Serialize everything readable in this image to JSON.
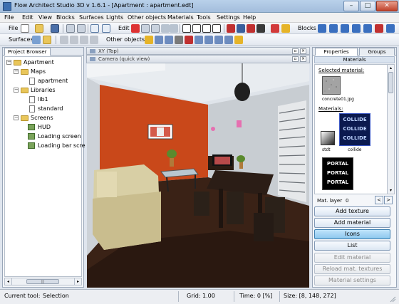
{
  "window": {
    "title": "Flow Architect Studio 3D v 1.6.1 - [Apartment : apartment.edt]",
    "minimize": "–",
    "maximize": "□",
    "close": "✕"
  },
  "menu": [
    "File",
    "Edit",
    "View",
    "Blocks",
    "Surfaces",
    "Lights",
    "Other objects",
    "Materials",
    "Tools",
    "Settings",
    "Help"
  ],
  "toolbar1": {
    "file": "File",
    "edit": "Edit",
    "blocks": "Blocks"
  },
  "toolbar2": {
    "surfaces": "Surfaces",
    "other_objects": "Other objects"
  },
  "project_browser": {
    "tab": "Project Browser",
    "tree": [
      {
        "label": "Apartment",
        "level": 0,
        "kind": "folder"
      },
      {
        "label": "Maps",
        "level": 1,
        "kind": "folder"
      },
      {
        "label": "apartment",
        "level": 2,
        "kind": "file"
      },
      {
        "label": "Libraries",
        "level": 1,
        "kind": "folder"
      },
      {
        "label": "lib1",
        "level": 2,
        "kind": "file"
      },
      {
        "label": "standard",
        "level": 2,
        "kind": "file"
      },
      {
        "label": "Screens",
        "level": 1,
        "kind": "folder"
      },
      {
        "label": "HUD",
        "level": 2,
        "kind": "screen"
      },
      {
        "label": "Loading screen",
        "level": 2,
        "kind": "screen"
      },
      {
        "label": "Loading bar scre",
        "level": 2,
        "kind": "screen"
      }
    ],
    "scroll_grip": "|||"
  },
  "documents": {
    "xy_title": "XY (Top)",
    "camera_title": "Camera (quick view)"
  },
  "right_panel": {
    "tabs": [
      "Properties",
      "Groups"
    ],
    "section_title": "Materials",
    "selected_label": "Selected material:",
    "selected_name": "concrete01.jpg",
    "materials_label": "Materials:",
    "thumbs": [
      {
        "name": "stdt"
      },
      {
        "name": "collide",
        "text": [
          "COLLIDE",
          "COLLIDE",
          "COLLIDE"
        ]
      },
      {
        "name": "",
        "text": [
          "PORTAL",
          "PORTAL",
          "PORTAL"
        ]
      }
    ],
    "mat_layer_label": "Mat. layer",
    "mat_layer_value": "0",
    "buttons": [
      {
        "label": "Add texture",
        "state": "normal"
      },
      {
        "label": "Add material",
        "state": "normal"
      },
      {
        "label": "Icons",
        "state": "selected"
      },
      {
        "label": "List",
        "state": "normal"
      },
      {
        "label": "Edit material",
        "state": "disabled"
      },
      {
        "label": "Reload mat. textures",
        "state": "disabled"
      },
      {
        "label": "Material settings",
        "state": "disabled"
      }
    ]
  },
  "status": {
    "current_tool_label": "Current tool:",
    "current_tool": "Selection",
    "grid": "Grid: 1.00",
    "time": "Time: 0 [%]",
    "size": "Size: [8, 148, 272]"
  }
}
